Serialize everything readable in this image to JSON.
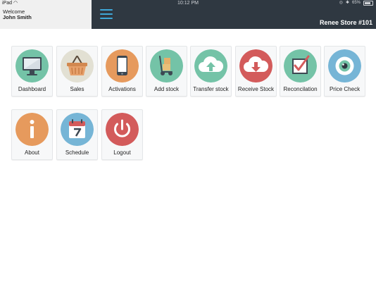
{
  "status_bar": {
    "device": "iPad",
    "time": "10:12 PM",
    "battery": "65%"
  },
  "header": {
    "welcome": "Welcome",
    "user": "John Smith",
    "store": "Renee Store #101",
    "menu_icon": "hamburger-menu-icon",
    "accent_color": "#3fa8d8",
    "bar_color": "#2f3841"
  },
  "tiles": [
    {
      "label": "Dashboard",
      "icon": "monitor-icon",
      "color": "#74c3a7"
    },
    {
      "label": "Sales",
      "icon": "basket-icon",
      "color": "#e2e0d3"
    },
    {
      "label": "Activations",
      "icon": "phone-icon",
      "color": "#e69a5d"
    },
    {
      "label": "Add stock",
      "icon": "hand-truck-icon",
      "color": "#74c3a7"
    },
    {
      "label": "Transfer stock",
      "icon": "cloud-upload-icon",
      "color": "#74c3a7"
    },
    {
      "label": "Receive Stock",
      "icon": "cloud-download-icon",
      "color": "#d35b5b"
    },
    {
      "label": "Reconcilation",
      "icon": "checkbox-icon",
      "color": "#74c3a7"
    },
    {
      "label": "Price Check",
      "icon": "eye-icon",
      "color": "#76b5d6"
    },
    {
      "label": "About",
      "icon": "info-icon",
      "color": "#e69a5d"
    },
    {
      "label": "Schedule",
      "icon": "calendar-icon",
      "color": "#76b5d6"
    },
    {
      "label": "Logout",
      "icon": "power-icon",
      "color": "#d35b5b"
    }
  ]
}
